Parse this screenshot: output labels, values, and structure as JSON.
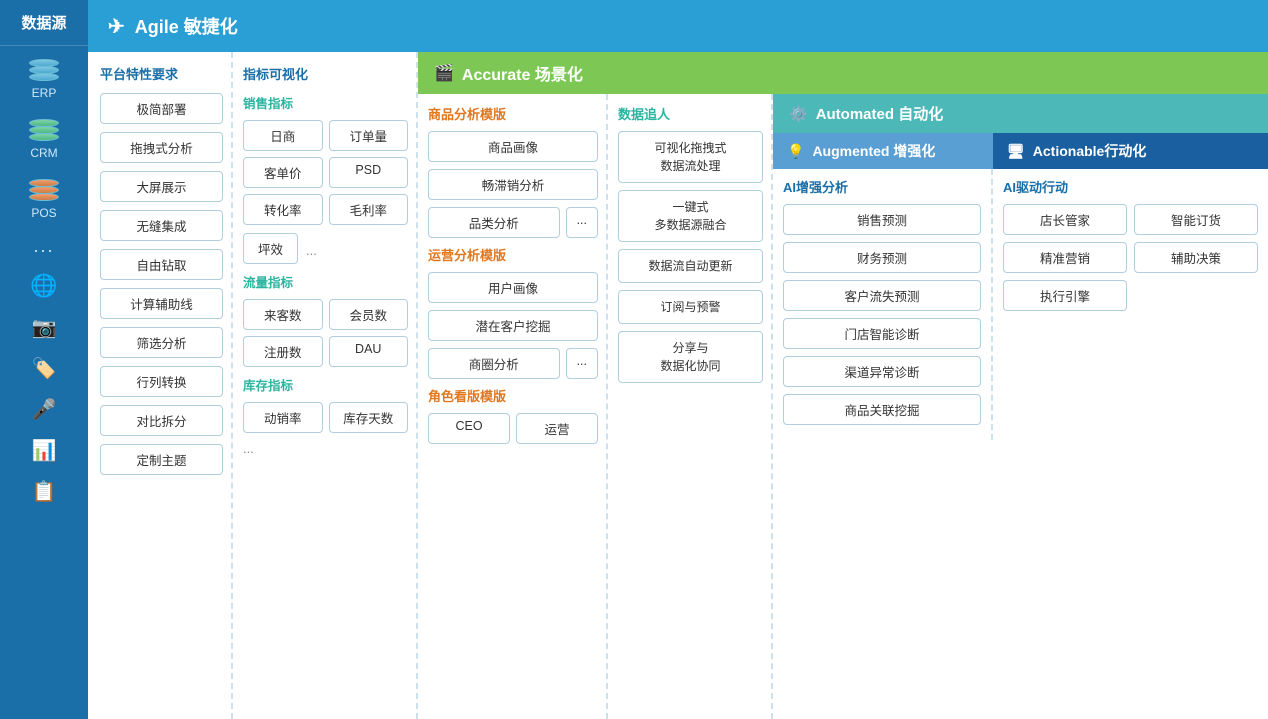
{
  "sidebar": {
    "header": "数据源",
    "items": [
      {
        "label": "ERP",
        "icon": "erp-db-icon"
      },
      {
        "label": "CRM",
        "icon": "crm-db-icon"
      },
      {
        "label": "POS",
        "icon": "pos-db-icon"
      },
      {
        "label": "...",
        "icon": "dots-icon"
      },
      {
        "label": "",
        "icon": "weibo-icon"
      },
      {
        "label": "",
        "icon": "camera-icon"
      },
      {
        "label": "",
        "icon": "tag-icon"
      },
      {
        "label": "",
        "icon": "mic-icon"
      },
      {
        "label": "",
        "icon": "excel-icon"
      },
      {
        "label": "",
        "icon": "copy-icon"
      }
    ]
  },
  "agile": {
    "header_label": "Agile 敏捷化"
  },
  "platform": {
    "title": "平台特性要求",
    "features": [
      "极简部署",
      "拖拽式分析",
      "大屏展示",
      "无缝集成",
      "自由钻取",
      "计算辅助线",
      "筛选分析",
      "行列转换",
      "对比拆分",
      "定制主题"
    ]
  },
  "metrics": {
    "title": "指标可视化",
    "sales_title": "销售指标",
    "sales_items": [
      "日商",
      "订单量",
      "客单价",
      "PSD",
      "转化率",
      "毛利率",
      "坪效"
    ],
    "sales_dots": "...",
    "traffic_title": "流量指标",
    "traffic_items": [
      "来客数",
      "会员数",
      "注册数",
      "DAU"
    ],
    "inventory_title": "库存指标",
    "inventory_items": [
      "动销率",
      "库存天数"
    ],
    "inventory_dots": "..."
  },
  "accurate": {
    "header_label": "Accurate 场景化",
    "goods_title": "商品分析模版",
    "goods_items": [
      "商品画像",
      "畅滞销分析",
      "品类分析"
    ],
    "goods_dots": "...",
    "ops_title": "运营分析模版",
    "ops_items": [
      "用户画像",
      "潜在客户挖掘",
      "商圈分析"
    ],
    "ops_dots": "...",
    "role_title": "角色看版模版",
    "role_items": [
      "CEO",
      "运营"
    ]
  },
  "tracker": {
    "title": "数据追人",
    "items": [
      "可视化拖拽式\n数据流处理",
      "一键式\n多数据源融合",
      "数据流自动更新",
      "订阅与预警",
      "分享与\n数据化协同"
    ]
  },
  "automated": {
    "header_label": "Automated 自动化"
  },
  "augmented": {
    "header_label": "Augmented 增强化",
    "ai_title": "AI增强分析",
    "items": [
      "销售预测",
      "财务预测",
      "客户流失预测",
      "门店智能诊断",
      "渠道异常诊断",
      "商品关联挖掘"
    ]
  },
  "actionable": {
    "header_label": "Actionable行动化",
    "ai_title": "AI驱动行动",
    "items": [
      "店长管家",
      "智能订货",
      "精准营销",
      "辅助决策",
      "执行引擎"
    ]
  }
}
